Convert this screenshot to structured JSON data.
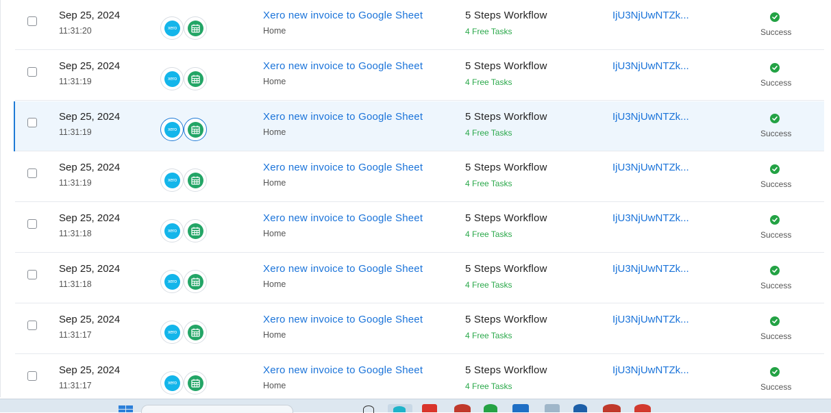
{
  "rows": [
    {
      "date": "Sep 25, 2024",
      "time": "11:31:20",
      "title": "Xero new invoice to Google Sheet",
      "folder": "Home",
      "steps": "5 Steps Workflow",
      "tasks": "4 Free Tasks",
      "run_id": "IjU3NjUwNTZk...",
      "status": "Success",
      "apps": [
        "xero",
        "google-sheets"
      ]
    },
    {
      "date": "Sep 25, 2024",
      "time": "11:31:19",
      "title": "Xero new invoice to Google Sheet",
      "folder": "Home",
      "steps": "5 Steps Workflow",
      "tasks": "4 Free Tasks",
      "run_id": "IjU3NjUwNTZk...",
      "status": "Success",
      "apps": [
        "xero",
        "google-sheets"
      ]
    },
    {
      "date": "Sep 25, 2024",
      "time": "11:31:19",
      "title": "Xero new invoice to Google Sheet",
      "folder": "Home",
      "steps": "5 Steps Workflow",
      "tasks": "4 Free Tasks",
      "run_id": "IjU3NjUwNTZk...",
      "status": "Success",
      "apps": [
        "xero",
        "google-sheets"
      ],
      "selected": true
    },
    {
      "date": "Sep 25, 2024",
      "time": "11:31:19",
      "title": "Xero new invoice to Google Sheet",
      "folder": "Home",
      "steps": "5 Steps Workflow",
      "tasks": "4 Free Tasks",
      "run_id": "IjU3NjUwNTZk...",
      "status": "Success",
      "apps": [
        "xero",
        "google-sheets"
      ]
    },
    {
      "date": "Sep 25, 2024",
      "time": "11:31:18",
      "title": "Xero new invoice to Google Sheet",
      "folder": "Home",
      "steps": "5 Steps Workflow",
      "tasks": "4 Free Tasks",
      "run_id": "IjU3NjUwNTZk...",
      "status": "Success",
      "apps": [
        "xero",
        "google-sheets"
      ]
    },
    {
      "date": "Sep 25, 2024",
      "time": "11:31:18",
      "title": "Xero new invoice to Google Sheet",
      "folder": "Home",
      "steps": "5 Steps Workflow",
      "tasks": "4 Free Tasks",
      "run_id": "IjU3NjUwNTZk...",
      "status": "Success",
      "apps": [
        "xero",
        "google-sheets"
      ]
    },
    {
      "date": "Sep 25, 2024",
      "time": "11:31:17",
      "title": "Xero new invoice to Google Sheet",
      "folder": "Home",
      "steps": "5 Steps Workflow",
      "tasks": "4 Free Tasks",
      "run_id": "IjU3NjUwNTZk...",
      "status": "Success",
      "apps": [
        "xero",
        "google-sheets"
      ]
    },
    {
      "date": "Sep 25, 2024",
      "time": "11:31:17",
      "title": "Xero new invoice to Google Sheet",
      "folder": "Home",
      "steps": "5 Steps Workflow",
      "tasks": "4 Free Tasks",
      "run_id": "IjU3NjUwNTZk...",
      "status": "Success",
      "apps": [
        "xero",
        "google-sheets"
      ]
    }
  ],
  "xero_badge_text": "xero",
  "colors": {
    "link": "#1a73d9",
    "success": "#23a244",
    "tasks": "#2aa84a",
    "xero": "#13b5ea",
    "sheets": "#23a566",
    "selected_bg": "#eef6fd",
    "selected_accent": "#1e7ad6"
  }
}
